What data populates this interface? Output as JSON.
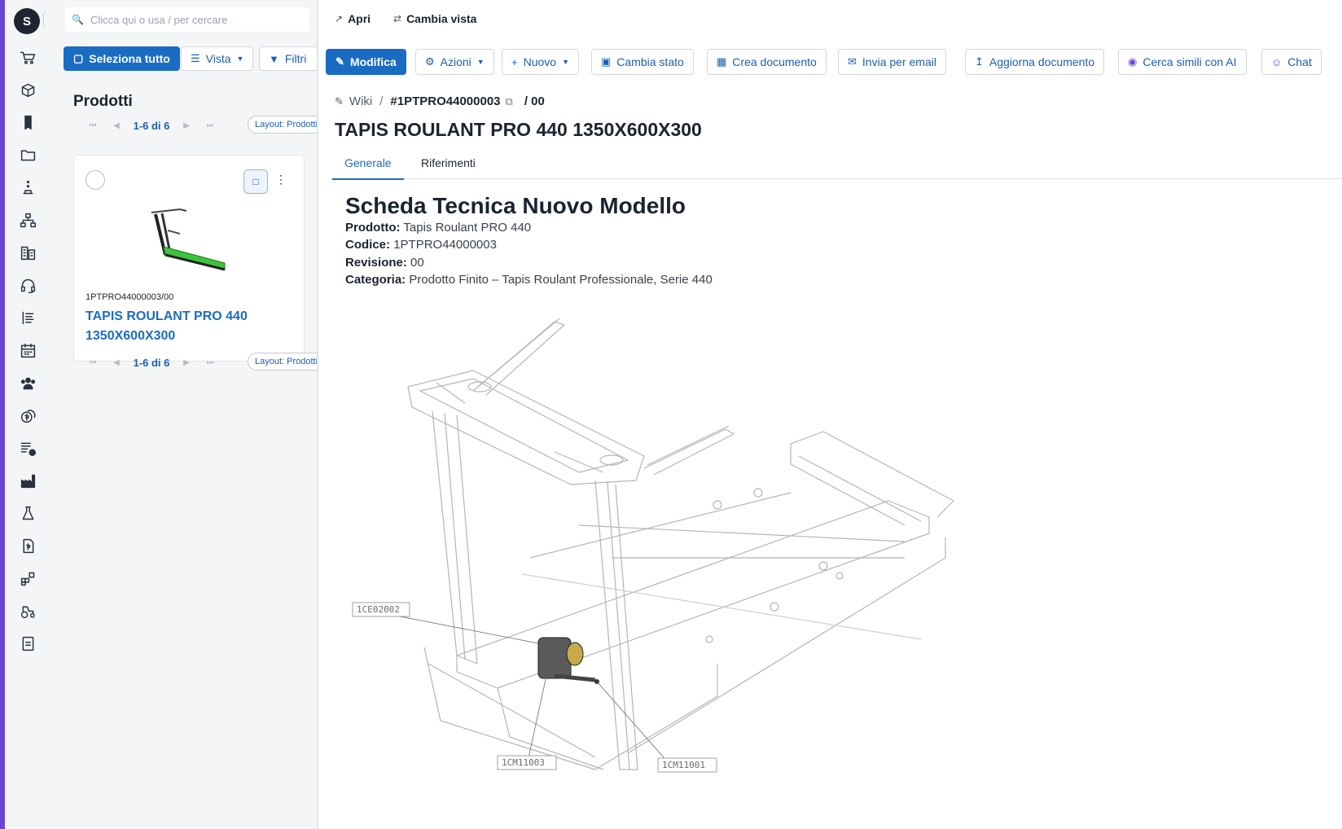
{
  "sidebar": {
    "logo_label": "S",
    "icons": [
      "cart-icon",
      "cube-stack-icon",
      "bookmark-icon",
      "folder-icon",
      "tree-dots-icon",
      "org-chart-icon",
      "buildings-icon",
      "headset-icon",
      "list-icon",
      "calendar-icon",
      "team-icon",
      "coins-icon",
      "tasks-clock-icon",
      "factory-icon",
      "flask-icon",
      "invoice-icon",
      "blocks-icon",
      "tractor-icon",
      "document-icon"
    ]
  },
  "left_panel": {
    "search_placeholder": "Clicca qui o usa / per cercare",
    "select_all": "Seleziona tutto",
    "view_label": "Vista",
    "filter_label": "Filtri",
    "title": "Prodotti",
    "pager_count": "1-6 di 6",
    "layout_label": "Layout: Prodotti",
    "card": {
      "code": "1PTPRO44000003/00",
      "name": "TAPIS ROULANT PRO 440 1350X600X300"
    }
  },
  "detail": {
    "open_label": "Apri",
    "change_view_label": "Cambia vista",
    "toolbar": {
      "edit": "Modifica",
      "actions": "Azioni",
      "new": "Nuovo",
      "change_state": "Cambia stato",
      "create_doc": "Crea documento",
      "send_email": "Invia per email",
      "update_doc": "Aggiorna documento",
      "find_similar": "Cerca simili con AI",
      "chat": "Chat"
    },
    "breadcrumb": {
      "root": "Wiki",
      "code": "#1PTPRO44000003",
      "revision": "/ 00"
    },
    "title": "TAPIS ROULANT PRO 440 1350X600X300",
    "tabs": [
      "Generale",
      "Riferimenti"
    ],
    "sheet": {
      "heading": "Scheda Tecnica Nuovo Modello",
      "fields": [
        {
          "label": "Prodotto:",
          "value": "Tapis Roulant PRO 440"
        },
        {
          "label": "Codice:",
          "value": "1PTPRO44000003"
        },
        {
          "label": "Revisione:",
          "value": "00"
        },
        {
          "label": "Categoria:",
          "value": "Prodotto Finito – Tapis Roulant Professionale, Serie 440"
        }
      ],
      "callouts": [
        "1CE02002",
        "1CM11003",
        "1CM11001"
      ]
    }
  },
  "colors": {
    "accent": "#6a44d8",
    "primary": "#1a6cc2",
    "link": "#1a5fb4",
    "belt": "#3ec23e"
  }
}
